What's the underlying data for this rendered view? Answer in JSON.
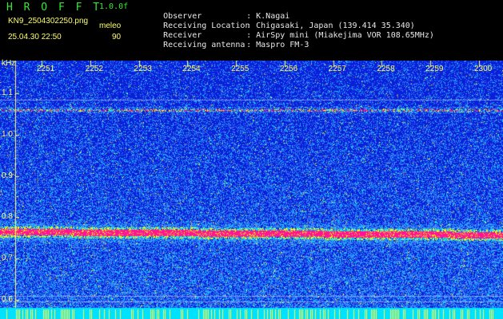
{
  "header": {
    "app_title": "H R O F F T",
    "version": "1.0.0f",
    "filename": "KN9_2504302250.png",
    "station_label": "meleo",
    "datetime": "25.04.30 22:50",
    "station_count": "90"
  },
  "info": [
    {
      "key": "Observer",
      "value": ": K.Nagai"
    },
    {
      "key": "Receiving Location",
      "value": ": Chigasaki, Japan (139.414 35.340)"
    },
    {
      "key": "Receiver",
      "value": ": AirSpy mini (Miakejima VOR 108.65MHz)"
    },
    {
      "key": "Receiving antenna",
      "value": ": Maspro FM-3"
    }
  ],
  "chart_data": {
    "type": "heatmap",
    "ylabel": "kHz",
    "y_ticks": [
      "1.1",
      "1.0",
      "0.9",
      "0.8",
      "0.7",
      "0.6"
    ],
    "x_ticks": [
      "2251",
      "2252",
      "2253",
      "2254",
      "2255",
      "2256",
      "2257",
      "2258",
      "2259",
      "2300"
    ],
    "ylim": [
      0.58,
      1.18
    ],
    "bands": [
      {
        "freq_khz": 1.06,
        "strength": "moderate"
      },
      {
        "freq_khz": 0.765,
        "strength": "strong"
      }
    ],
    "colors": {
      "background": "#0a1fd8",
      "noise": "#3c8cff",
      "weak": "#00e0ff",
      "mid": "#ffff00",
      "strong": "#ff1493"
    }
  }
}
